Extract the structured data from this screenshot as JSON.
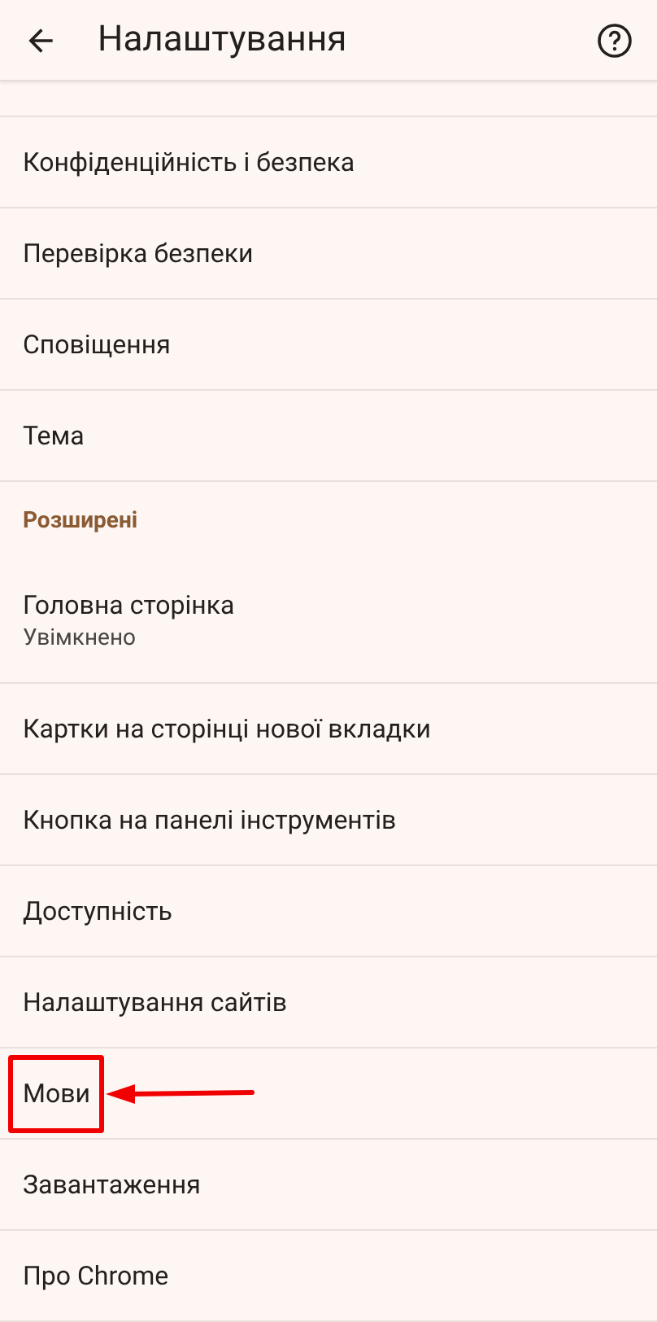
{
  "app_bar": {
    "title": "Налаштування"
  },
  "items": [
    {
      "kind": "item",
      "label": "Конфіденційність і безпека",
      "highlighted": false
    },
    {
      "kind": "item",
      "label": "Перевірка безпеки",
      "highlighted": false
    },
    {
      "kind": "item",
      "label": "Сповіщення",
      "highlighted": false
    },
    {
      "kind": "item",
      "label": "Тема",
      "highlighted": false
    },
    {
      "kind": "header",
      "label": "Розширені"
    },
    {
      "kind": "item",
      "label": "Головна сторінка",
      "subtitle": "Увімкнено",
      "highlighted": false
    },
    {
      "kind": "item",
      "label": "Картки на сторінці нової вкладки",
      "highlighted": false
    },
    {
      "kind": "item",
      "label": "Кнопка на панелі інструментів",
      "highlighted": false
    },
    {
      "kind": "item",
      "label": "Доступність",
      "highlighted": false
    },
    {
      "kind": "item",
      "label": "Налаштування сайтів",
      "highlighted": false
    },
    {
      "kind": "item",
      "label": "Мови",
      "highlighted": true
    },
    {
      "kind": "item",
      "label": "Завантаження",
      "highlighted": false
    },
    {
      "kind": "item",
      "label": "Про Chrome",
      "highlighted": false
    }
  ]
}
